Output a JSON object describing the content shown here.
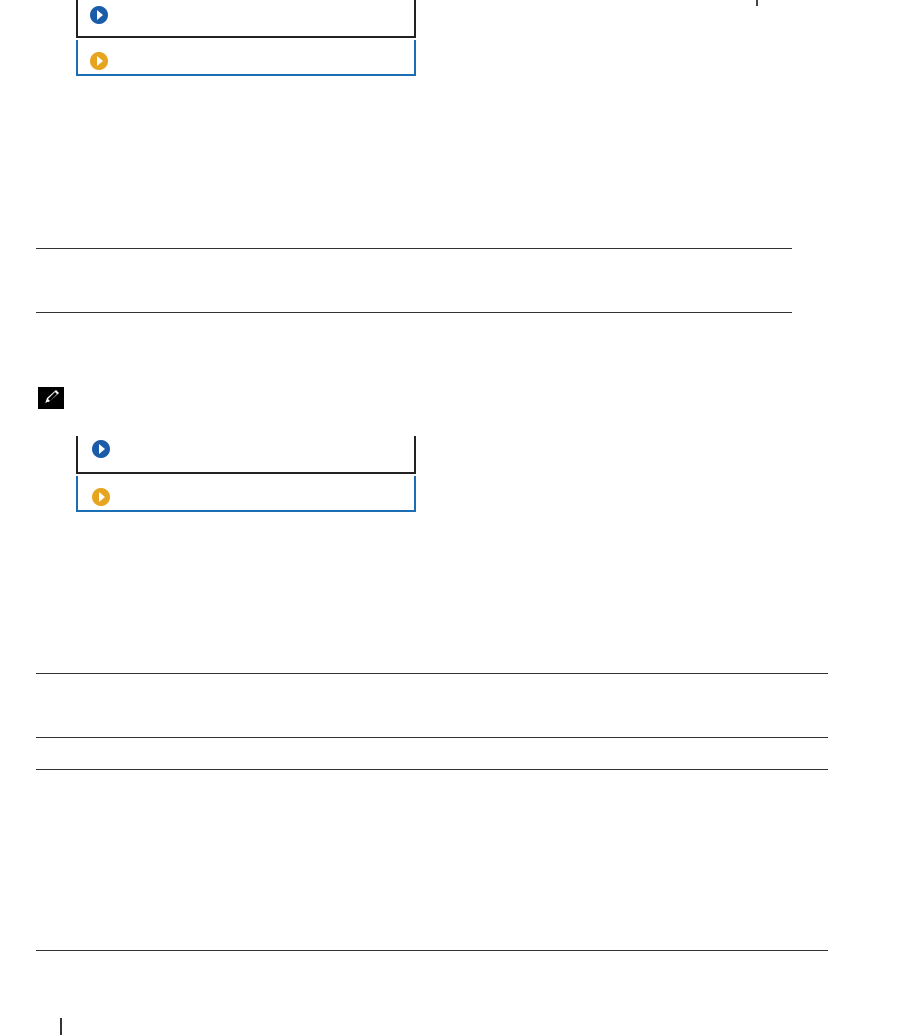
{
  "colors": {
    "primary_link": "#1b5ca8",
    "secondary_link": "#e7a41f",
    "blue_border": "#1d6db5",
    "rule": "#333333"
  },
  "callouts": [
    {
      "primary_icon": "play-circle-icon",
      "secondary_icon": "play-circle-icon"
    },
    {
      "primary_icon": "play-circle-icon",
      "secondary_icon": "play-circle-icon"
    }
  ],
  "note": {
    "icon": "note-pencil-icon"
  }
}
